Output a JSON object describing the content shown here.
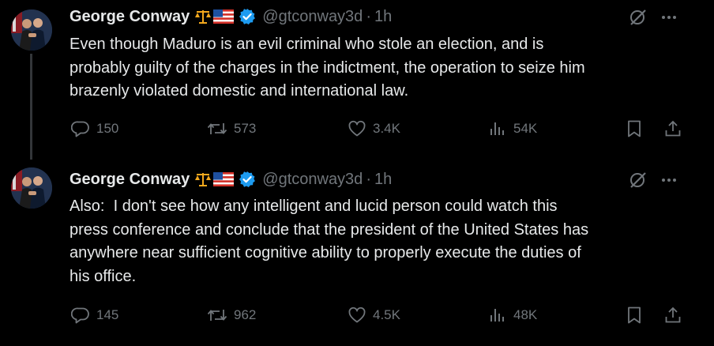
{
  "tweets": [
    {
      "author": "George Conway",
      "emoji": [
        "scales-emoji",
        "us-flag-emoji"
      ],
      "handle": "@gtconway3d",
      "separator": "·",
      "time": "1h",
      "text": "Even though Maduro is an evil criminal who stole an election, and is\nprobably guilty of the charges in the indictment, the operation to seize him\nbrazenly violated domestic and international law.",
      "replies": "150",
      "reposts": "573",
      "likes": "3.4K",
      "views": "54K"
    },
    {
      "author": "George Conway",
      "emoji": [
        "scales-emoji",
        "us-flag-emoji"
      ],
      "handle": "@gtconway3d",
      "separator": "·",
      "time": "1h",
      "text": "Also:  I don't see how any intelligent and lucid person could watch this\npress conference and conclude that the president of the United States has\nanywhere near sufficient cognitive ability to properly execute the duties of\nhis office.",
      "replies": "145",
      "reposts": "962",
      "likes": "4.5K",
      "views": "48K"
    }
  ],
  "colors": {
    "background": "#000000",
    "text": "#e7e9ea",
    "muted": "#71767b",
    "verified": "#1d9bf0",
    "thread_line": "#333639"
  },
  "icons": [
    "grok-icon",
    "more-icon",
    "reply-icon",
    "repost-icon",
    "like-icon",
    "views-icon",
    "bookmark-icon",
    "share-icon",
    "verified-badge-icon"
  ]
}
